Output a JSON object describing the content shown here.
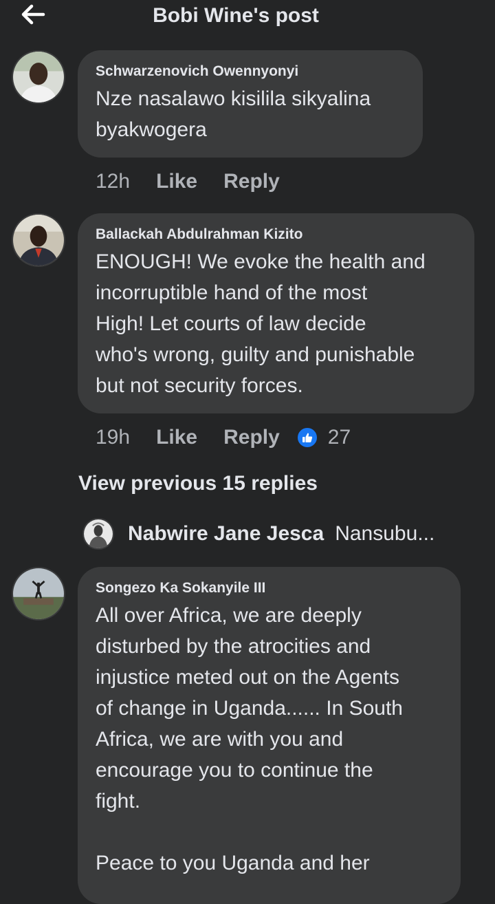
{
  "header": {
    "title": "Bobi Wine's post"
  },
  "comments": [
    {
      "author": "Schwarzenovich Owennyonyi",
      "lines": [
        "Nze nasalawo kisilila sikyalina",
        "byakwogera"
      ],
      "time": "12h",
      "like": "Like",
      "reply": "Reply"
    },
    {
      "author": "Ballackah Abdulrahman Kizito",
      "lines": [
        "ENOUGH! We evoke the health and",
        "incorruptible hand of the most",
        "High! Let courts of law decide",
        "who's wrong, guilty and punishable",
        "but not security forces."
      ],
      "time": "19h",
      "like": "Like",
      "reply": "Reply",
      "reactions": "27",
      "reaction_icon": "thumbs-up-icon",
      "reaction_color": "#1877f2"
    },
    {
      "author": "Songezo Ka Sokanyile III",
      "lines": [
        "All over Africa, we are deeply",
        "disturbed by the atrocities and",
        "injustice meted out on the Agents",
        "of change in Uganda...... In South",
        "Africa, we are with you and",
        "encourage you to continue the",
        "fight.",
        "",
        "Peace to you Uganda and her"
      ]
    }
  ],
  "view_previous": "View previous 15 replies",
  "reply_preview": {
    "name": "Nabwire Jane Jesca",
    "snippet": "Nansubu..."
  }
}
